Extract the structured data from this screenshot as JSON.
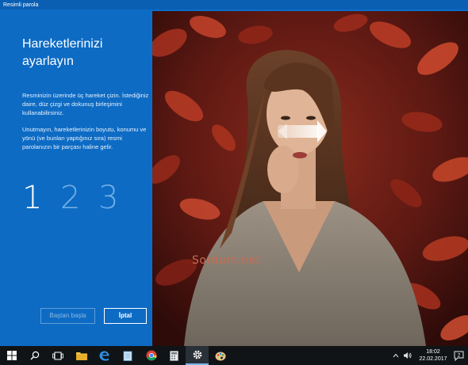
{
  "window": {
    "title": "Resimli parola"
  },
  "panel": {
    "heading": "Hareketlerinizi ayarlayın",
    "paragraph1": "Resminizin üzerinde üç hareket çizin. İstediğiniz daire, düz çizgi ve dokunuş birleşimini kullanabilirsiniz.",
    "paragraph2": "Unutmayın, hareketlerinizin boyutu, konumu ve yönü (ve bunları yaptığınız sıra) resmi parolanızın bir parçası haline gelir.",
    "steps": [
      "1",
      "2",
      "3"
    ],
    "active_step": 1,
    "restart_label": "Baştan başla",
    "cancel_label": "İptal"
  },
  "image": {
    "watermark": "Sordum.net",
    "gesture": "swipe-right-arrow"
  },
  "taskbar": {
    "icons": [
      "windows-start-icon",
      "search-icon",
      "task-view-icon",
      "file-explorer-icon",
      "edge-icon",
      "notepad-icon",
      "chrome-icon",
      "calculator-icon",
      "settings-icon",
      "paint-icon"
    ],
    "clock_time": "18:02",
    "clock_date": "22.02.2017",
    "notification_count": "2",
    "colors": {
      "taskbar": "#101417",
      "active_underline": "#7eb6ec"
    }
  },
  "colors": {
    "accent": "#0d6bc4",
    "pending_step": "#71aee6"
  }
}
